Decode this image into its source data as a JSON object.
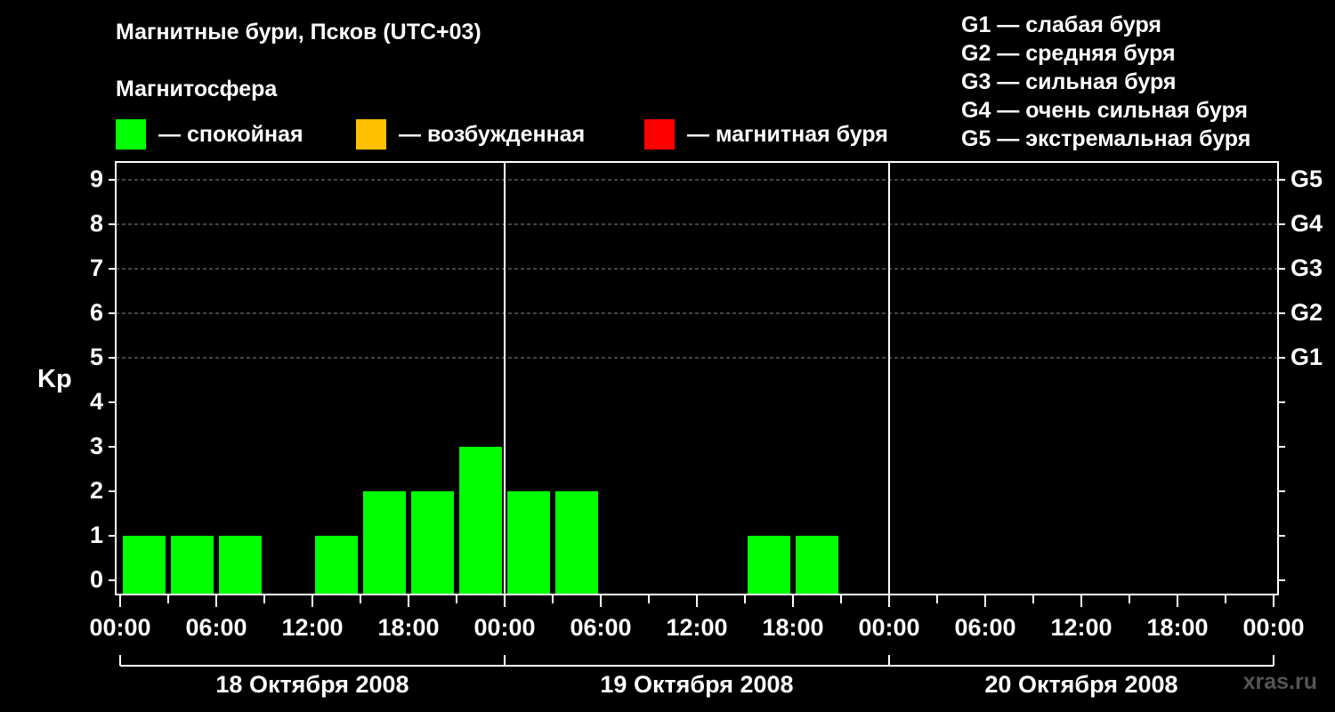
{
  "title": "Магнитные бури, Псков (UTC+03)",
  "subtitle": "Магнитосфера",
  "legend": [
    {
      "color": "#00ff00",
      "label": "— спокойная"
    },
    {
      "color": "#ffc000",
      "label": "— возбужденная"
    },
    {
      "color": "#ff0000",
      "label": "— магнитная буря"
    }
  ],
  "g_legend": [
    "G1 — слабая буря",
    "G2 — средняя буря",
    "G3 — сильная буря",
    "G4 — очень сильная буря",
    "G5 — экстремальная буря"
  ],
  "watermark": "xras.ru",
  "chart_data": {
    "type": "bar",
    "ylabel": "Kp",
    "ylim": [
      0,
      9
    ],
    "y_ticks": [
      0,
      1,
      2,
      3,
      4,
      5,
      6,
      7,
      8,
      9
    ],
    "right_ticks": [
      {
        "value": 5,
        "label": "G1"
      },
      {
        "value": 6,
        "label": "G2"
      },
      {
        "value": 7,
        "label": "G3"
      },
      {
        "value": 8,
        "label": "G4"
      },
      {
        "value": 9,
        "label": "G5"
      }
    ],
    "x_tick_labels": [
      "00:00",
      "06:00",
      "12:00",
      "18:00",
      "00:00",
      "06:00",
      "12:00",
      "18:00",
      "00:00",
      "06:00",
      "12:00",
      "18:00",
      "00:00"
    ],
    "days": [
      "18 Октября 2008",
      "19 Октября 2008",
      "20 Октября 2008"
    ],
    "interval_hours": 3,
    "values": [
      1,
      1,
      1,
      0,
      1,
      2,
      2,
      3,
      2,
      2,
      0,
      0,
      0,
      1,
      1,
      0
    ],
    "bar_color": "#00ff00",
    "grid": "dashed at 5–9",
    "day_separators": true
  }
}
